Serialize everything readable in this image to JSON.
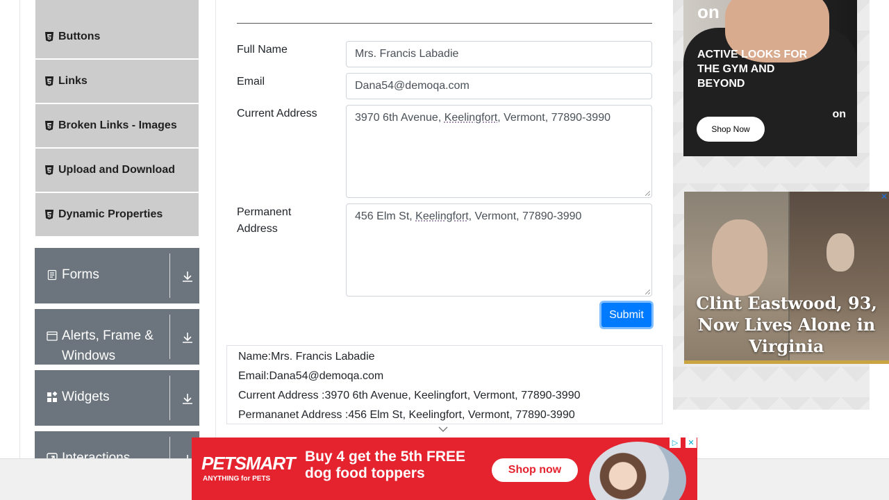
{
  "sidebar": {
    "items": [
      {
        "label": "Buttons"
      },
      {
        "label": "Links"
      },
      {
        "label": "Broken Links - Images"
      },
      {
        "label": "Upload and Download"
      },
      {
        "label": "Dynamic Properties"
      }
    ],
    "groups": [
      {
        "label": "Forms",
        "icon": "document-icon"
      },
      {
        "label": "Alerts, Frame & Windows",
        "icon": "window-icon"
      },
      {
        "label": "Widgets",
        "icon": "widgets-icon"
      },
      {
        "label": "Interactions",
        "icon": "interactions-icon"
      }
    ]
  },
  "form": {
    "full_name_label": "Full Name",
    "full_name_value": "Mrs. Francis Labadie",
    "email_label": "Email",
    "email_value": "Dana54@demoqa.com",
    "current_address_label": "Current Address",
    "current_address_pre": "3970 6th Avenue, ",
    "current_address_city": "Keelingfort",
    "current_address_post": ", Vermont, 77890-3990",
    "permanent_address_label": "Permanent Address",
    "permanent_address_pre": "456 Elm St, ",
    "permanent_address_city": "Keelingfort",
    "permanent_address_post": ", Vermont, 77890-3990",
    "submit_label": "Submit"
  },
  "output": {
    "name": "Name:Mrs. Francis Labadie",
    "email": "Email:Dana54@demoqa.com",
    "current_address": "Current Address :3970 6th Avenue, Keelingfort, Vermont, 77890-3990",
    "permanent_address": "Permananet Address :456 Elm St, Keelingfort, Vermont, 77890-3990"
  },
  "ads": {
    "on": {
      "logo": "on",
      "headline": "ACTIVE LOOKS FOR THE GYM AND BEYOND",
      "button": "Shop Now"
    },
    "clint": {
      "caption": "Clint Eastwood, 93, Now Lives Alone in Virginia"
    },
    "petsmart": {
      "brand": "PETSMART",
      "tagline": "ANYTHING for PETS",
      "offer": "Buy 4 get the 5th FREE dog food toppers",
      "button": "Shop now"
    }
  },
  "colors": {
    "primary": "#007bff",
    "sidebar_group": "#6c757d",
    "sidebar_item": "#cccccc",
    "petsmart_red": "#e4232f"
  }
}
